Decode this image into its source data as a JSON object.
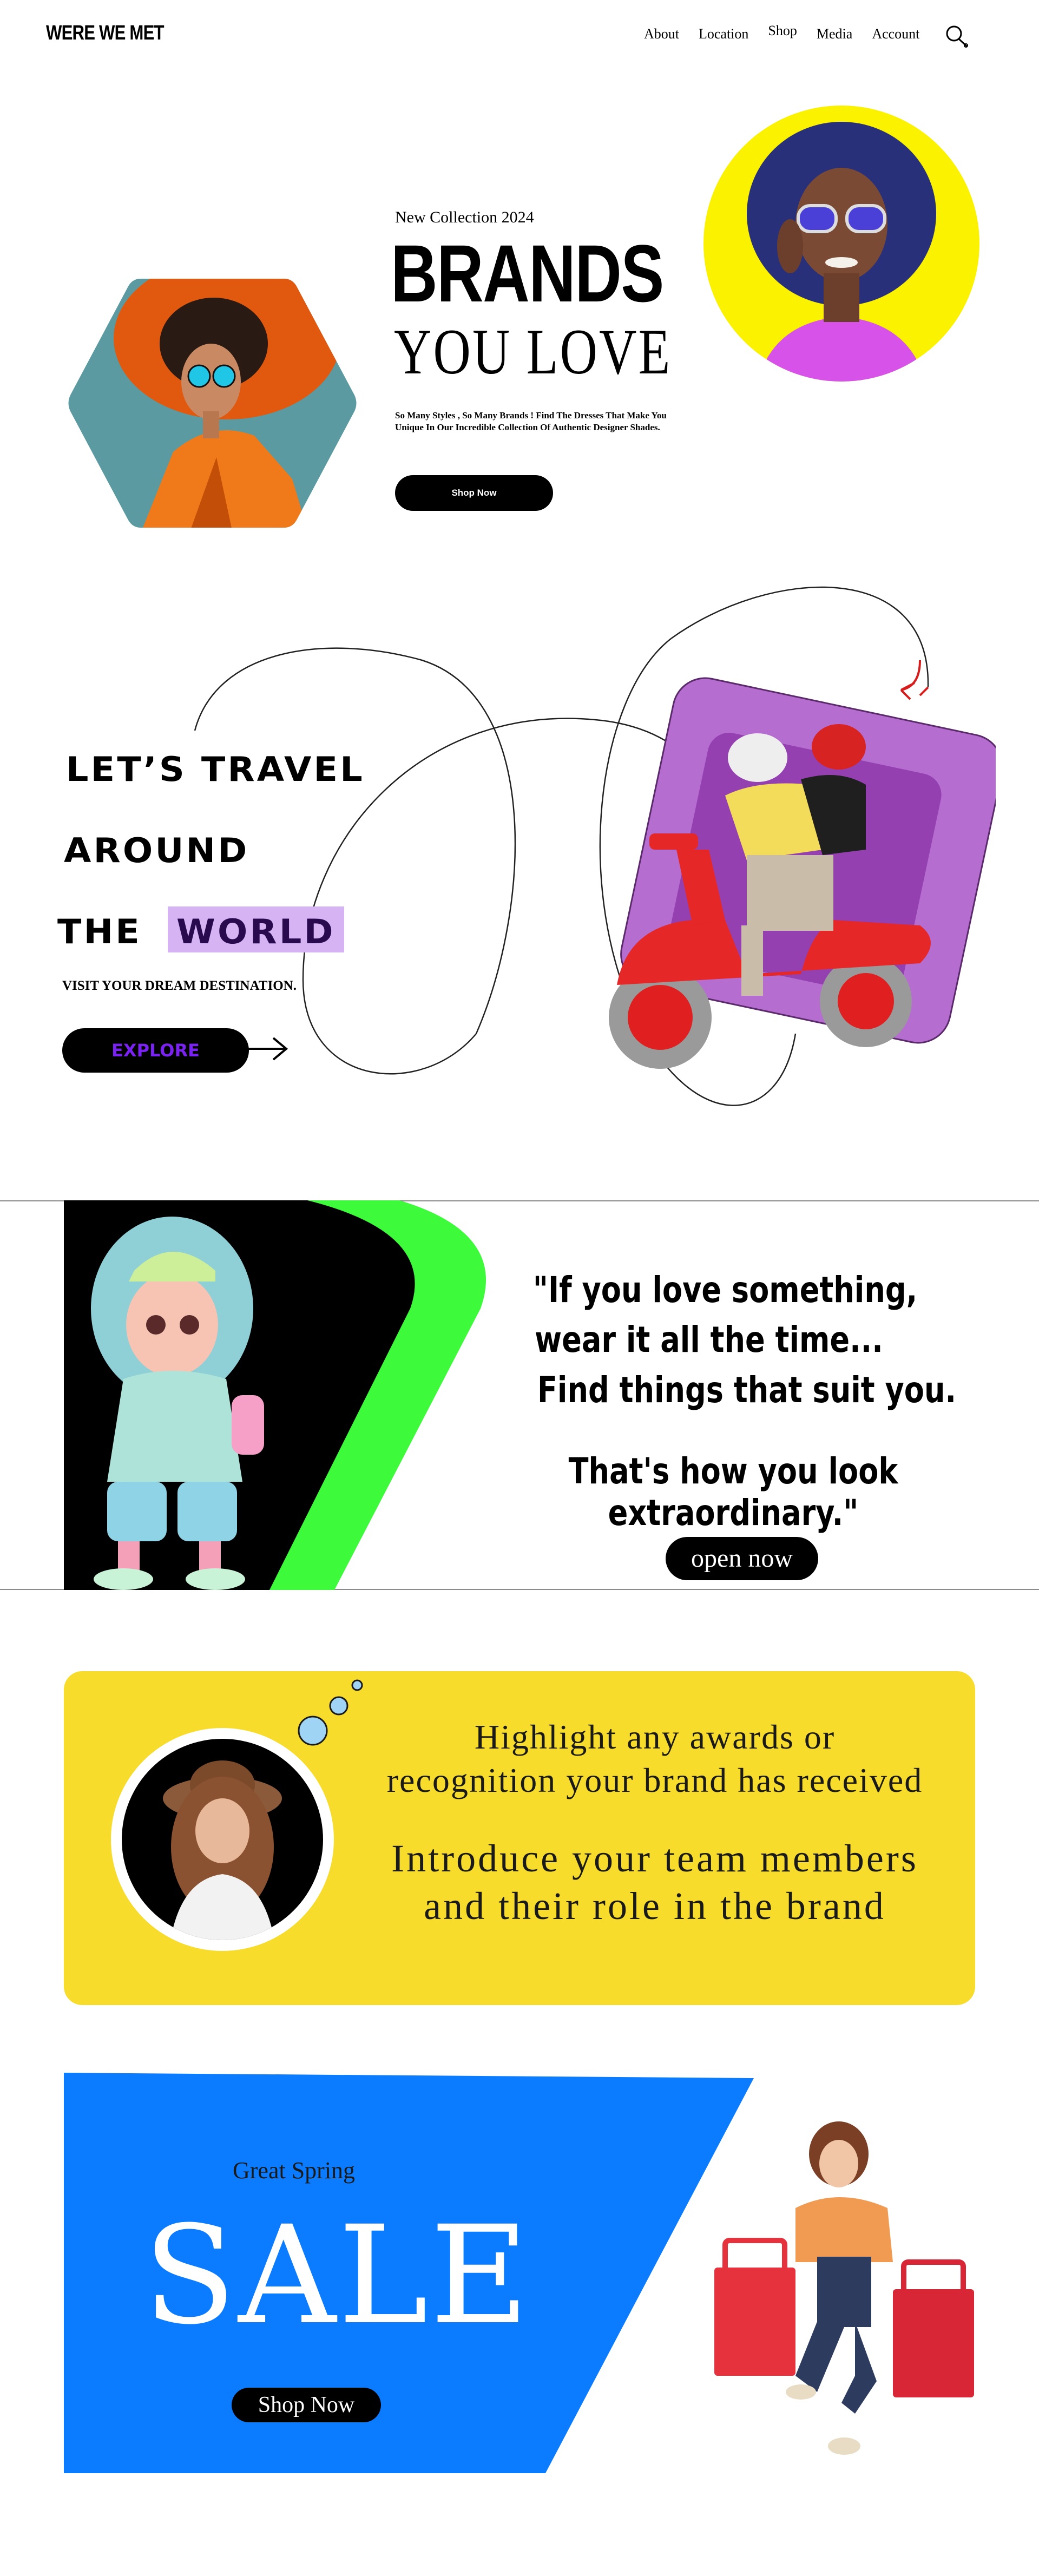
{
  "header": {
    "logo": "WERE WE MET",
    "nav": [
      "About",
      "Location",
      "Shop",
      "Media",
      "Account"
    ],
    "search_icon": "search-icon"
  },
  "hero": {
    "kicker": "New Collection 2024",
    "title": "BRANDS",
    "subtitle": "YOU LOVE",
    "description_line1": "So Many Styles , So Many Brands ! Find The Dresses That Make You",
    "description_line2": "Unique In Our Incredible Collection Of Authentic Designer Shades.",
    "button": "Shop Now",
    "colors": {
      "hexagon": "#5a9aa0",
      "circle": "#fbf200"
    }
  },
  "travel": {
    "line1": "LET’S  TRAVEL",
    "line2": "AROUND",
    "line3_a": "THE",
    "line3_b": "WORLD",
    "tagline": "VISIT YOUR DREAM DESTINATION.",
    "button": "EXPLORE",
    "colors": {
      "highlight": "#d6b3f3",
      "card": "#b56ecf",
      "button_text": "#7a22f2"
    }
  },
  "quote": {
    "line1": "\"If you love something,",
    "line2": "wear it all the time...",
    "line3": "Find things that suit you.",
    "line4": "That's how you look extraordinary.\"",
    "button": "open now",
    "colors": {
      "accent": "#3dfb3a"
    }
  },
  "about": {
    "line1": "Highlight any awards or",
    "line2": "recognition your brand has received",
    "line3": "Introduce your team members",
    "line4": "and their role in the brand",
    "colors": {
      "card": "#f8dc2b",
      "bubble": "#9fd4f5"
    }
  },
  "sale": {
    "kicker": "Great Spring",
    "title": "SALE",
    "button": "Shop Now",
    "colors": {
      "panel": "#0b7cff"
    }
  }
}
